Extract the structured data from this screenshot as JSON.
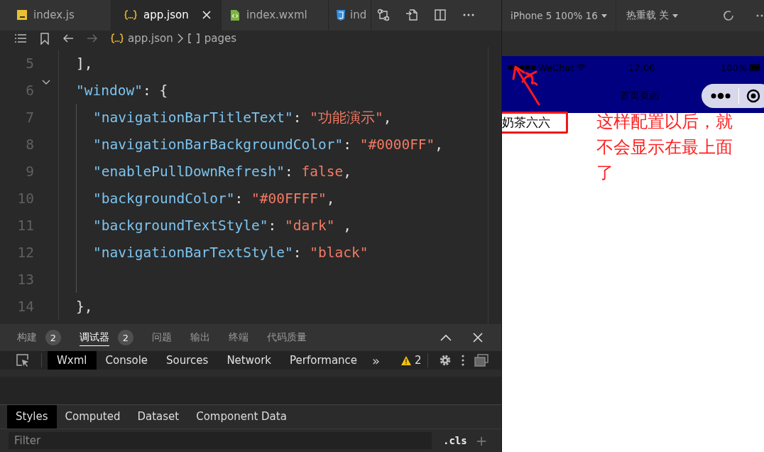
{
  "editor_tabs": [
    {
      "label": "index.js",
      "kind": "js",
      "selected": false,
      "closable": false
    },
    {
      "label": "app.json",
      "kind": "json",
      "selected": true,
      "closable": true
    },
    {
      "label": "index.wxml",
      "kind": "wxml",
      "selected": false,
      "closable": false
    },
    {
      "label": "ind",
      "kind": "css",
      "selected": false,
      "closable": false
    }
  ],
  "breadcrumb": {
    "file": "app.json",
    "symbol": "pages"
  },
  "code_lines": [
    {
      "number": "5",
      "tokens": [
        {
          "kind": "punct",
          "text": "],"
        }
      ]
    },
    {
      "number": "6",
      "expanded": true,
      "tokens": [
        {
          "kind": "key",
          "text": "\"window\""
        },
        {
          "kind": "punct",
          "text": ": {"
        }
      ],
      "children": [
        {
          "number": "7",
          "tokens": [
            {
              "kind": "key",
              "text": "\"navigationBarTitleText\""
            },
            {
              "kind": "punct",
              "text": ": "
            },
            {
              "kind": "string",
              "text": "\"功能演示\""
            },
            {
              "kind": "punct",
              "text": ","
            }
          ]
        },
        {
          "number": "8",
          "tokens": [
            {
              "kind": "key",
              "text": "\"navigationBarBackgroundColor\""
            },
            {
              "kind": "punct",
              "text": ": "
            },
            {
              "kind": "string",
              "text": "\"#0000FF\""
            },
            {
              "kind": "punct",
              "text": ","
            }
          ]
        },
        {
          "number": "9",
          "tokens": [
            {
              "kind": "key",
              "text": "\"enablePullDownRefresh\""
            },
            {
              "kind": "punct",
              "text": ": "
            },
            {
              "kind": "string",
              "text": "false"
            },
            {
              "kind": "punct",
              "text": ","
            }
          ]
        },
        {
          "number": "10",
          "tokens": [
            {
              "kind": "key",
              "text": "\"backgroundColor\""
            },
            {
              "kind": "punct",
              "text": ": "
            },
            {
              "kind": "string",
              "text": "\"#00FFFF\""
            },
            {
              "kind": "punct",
              "text": ","
            }
          ]
        },
        {
          "number": "11",
          "tokens": [
            {
              "kind": "key",
              "text": "\"backgroundTextStyle\""
            },
            {
              "kind": "punct",
              "text": ": "
            },
            {
              "kind": "string",
              "text": "\"dark\""
            },
            {
              "kind": "punct",
              "text": " ,"
            }
          ]
        },
        {
          "number": "12",
          "tokens": [
            {
              "kind": "key",
              "text": "\"navigationBarTextStyle\""
            },
            {
              "kind": "punct",
              "text": ": "
            },
            {
              "kind": "string",
              "text": "\"black\""
            }
          ]
        },
        {
          "number": "13"
        }
      ]
    },
    {
      "number": "14",
      "tokens": [
        {
          "kind": "punct",
          "text": "},"
        }
      ]
    }
  ],
  "panel_tabs": [
    {
      "label": "构建",
      "count": "2",
      "selected": false
    },
    {
      "label": "调试器",
      "count": "2",
      "selected": true
    },
    {
      "label": "问题",
      "selected": false
    },
    {
      "label": "输出",
      "selected": false
    },
    {
      "label": "终端",
      "selected": false
    },
    {
      "label": "代码质量",
      "selected": false
    }
  ],
  "devtools_tabs": [
    {
      "label": "Wxml",
      "selected": true
    },
    {
      "label": "Console",
      "selected": false
    },
    {
      "label": "Sources",
      "selected": false
    },
    {
      "label": "Network",
      "selected": false
    },
    {
      "label": "Performance",
      "selected": false
    }
  ],
  "devtools_more": "»",
  "warning_count": "2",
  "style_tabs": [
    {
      "label": "Styles",
      "selected": true
    },
    {
      "label": "Computed",
      "selected": false
    },
    {
      "label": "Dataset",
      "selected": false
    },
    {
      "label": "Component Data",
      "selected": false
    }
  ],
  "filter": {
    "placeholder": "Filter",
    "cls": ".cls",
    "add": "+"
  },
  "simulator": {
    "device": "iPhone 5 100% 16",
    "hot_reload": "热重载 关",
    "status_bar": {
      "carrier": "WeChat",
      "time": "17:06",
      "battery": "100%"
    },
    "nav_title": "首页页面",
    "page_text": "奶茶六六",
    "annotation": "这样配置以后，就不会显示在最上面了"
  }
}
